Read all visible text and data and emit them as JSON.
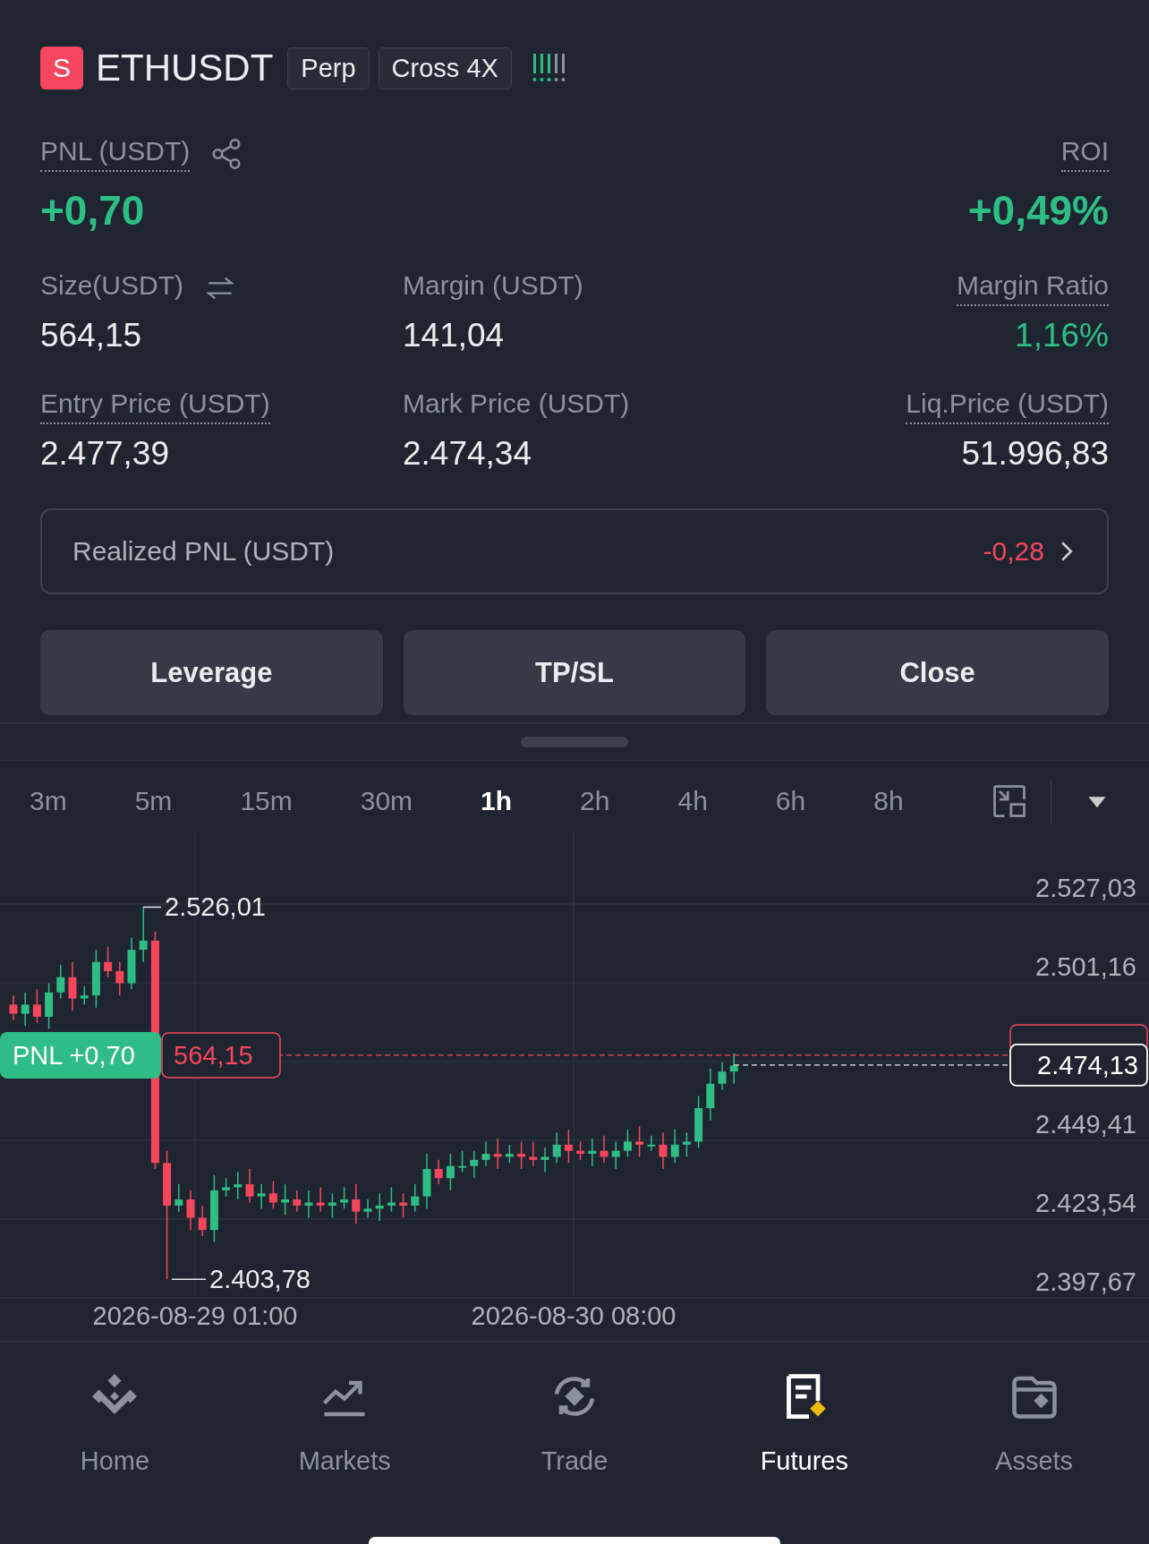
{
  "header": {
    "symbol_badge": "S",
    "symbol": "ETHUSDT",
    "tags": [
      "Perp",
      "Cross 4X"
    ]
  },
  "position": {
    "pnl_label": "PNL (USDT)",
    "pnl_value": "+0,70",
    "roi_label": "ROI",
    "roi_value": "+0,49%",
    "stats": [
      {
        "label": "Size(USDT)",
        "value": "564,15",
        "dotted": false,
        "swap_icon": true,
        "positive": false
      },
      {
        "label": "Margin (USDT)",
        "value": "141,04",
        "dotted": false,
        "swap_icon": false,
        "positive": false
      },
      {
        "label": "Margin Ratio",
        "value": "1,16%",
        "dotted": true,
        "swap_icon": false,
        "positive": true
      },
      {
        "label": "Entry Price (USDT)",
        "value": "2.477,39",
        "dotted": true,
        "swap_icon": false,
        "positive": false
      },
      {
        "label": "Mark Price (USDT)",
        "value": "2.474,34",
        "dotted": false,
        "swap_icon": false,
        "positive": false
      },
      {
        "label": "Liq.Price (USDT)",
        "value": "51.996,83",
        "dotted": true,
        "swap_icon": false,
        "positive": false
      }
    ]
  },
  "realized": {
    "label": "Realized PNL (USDT)",
    "value": "-0,28"
  },
  "actions": [
    "Leverage",
    "TP/SL",
    "Close"
  ],
  "timeframes": [
    {
      "label": "3m",
      "selected": false
    },
    {
      "label": "5m",
      "selected": false
    },
    {
      "label": "15m",
      "selected": false
    },
    {
      "label": "30m",
      "selected": false
    },
    {
      "label": "1h",
      "selected": true
    },
    {
      "label": "2h",
      "selected": false
    },
    {
      "label": "4h",
      "selected": false
    },
    {
      "label": "6h",
      "selected": false
    },
    {
      "label": "8h",
      "selected": false
    }
  ],
  "chart": {
    "y_labels": [
      "2.527,03",
      "2.501,16",
      "2.449,41",
      "2.423,54",
      "2.397,67"
    ],
    "x_labels": [
      "2026-08-29 01:00",
      "2026-08-30 08:00"
    ],
    "high_label": "2.526,01",
    "low_label": "2.403,78",
    "pnl_tag": "PNL +0,70",
    "size_tag": "564,15",
    "last_price": "2.474,13"
  },
  "nav": [
    {
      "label": "Home",
      "kind": "home",
      "selected": false
    },
    {
      "label": "Markets",
      "kind": "markets",
      "selected": false
    },
    {
      "label": "Trade",
      "kind": "trade",
      "selected": false
    },
    {
      "label": "Futures",
      "kind": "futures",
      "selected": true
    },
    {
      "label": "Assets",
      "kind": "assets",
      "selected": false
    }
  ]
}
